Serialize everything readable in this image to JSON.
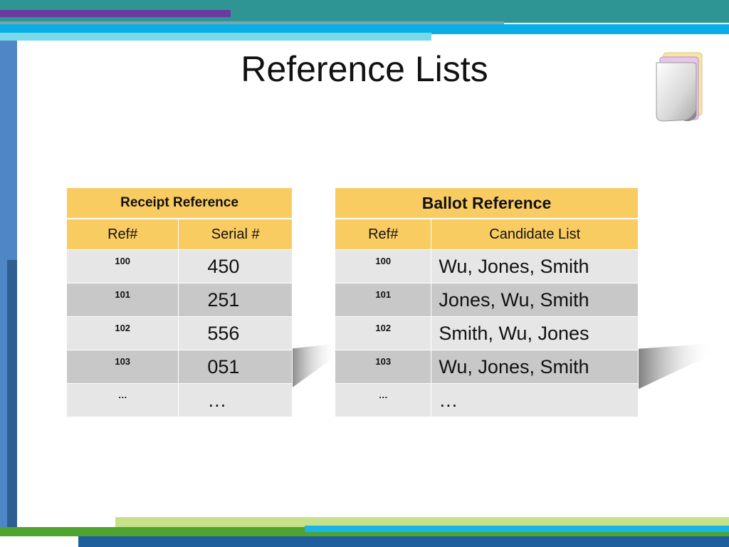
{
  "slide": {
    "title": "Reference Lists",
    "accent_colors": {
      "header": "#f9cc62",
      "row_light": "#e6e6e6",
      "row_dark": "#c8c8c8",
      "teal": "#2e9494",
      "purple": "#6a3b9e",
      "blue": "#0aaee6",
      "green": "#4fa32f"
    },
    "icon": "document-stack-icon"
  },
  "receipt": {
    "title": "Receipt Reference",
    "columns": [
      "Ref#",
      "Serial #"
    ],
    "rows": [
      {
        "ref": "100",
        "value": "450"
      },
      {
        "ref": "101",
        "value": "251"
      },
      {
        "ref": "102",
        "value": "556"
      },
      {
        "ref": "103",
        "value": "051"
      },
      {
        "ref": "…",
        "value": "…"
      }
    ]
  },
  "ballot": {
    "title": "Ballot Reference",
    "columns": [
      "Ref#",
      "Candidate List"
    ],
    "rows": [
      {
        "ref": "100",
        "value": "Wu, Jones, Smith"
      },
      {
        "ref": "101",
        "value": "Jones, Wu, Smith"
      },
      {
        "ref": "102",
        "value": "Smith, Wu, Jones"
      },
      {
        "ref": "103",
        "value": "Wu, Jones, Smith"
      },
      {
        "ref": "…",
        "value": "…"
      }
    ]
  }
}
